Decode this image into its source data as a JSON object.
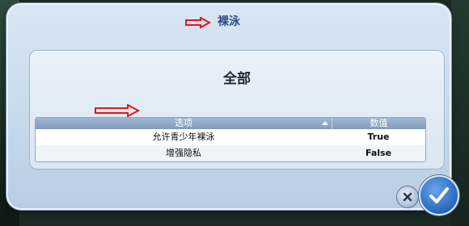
{
  "dialog": {
    "title": "裸泳",
    "section_title": "全部"
  },
  "table": {
    "headers": {
      "option": "选项",
      "value": "数值"
    },
    "rows": [
      {
        "option": "允许青少年裸泳",
        "value": "True"
      },
      {
        "option": "增强隐私",
        "value": "False"
      }
    ]
  },
  "buttons": {
    "cancel_icon": "close-icon",
    "ok_icon": "checkmark-icon"
  },
  "colors": {
    "annotation_arrow": "#e01818",
    "title_text": "#2d4f86",
    "ok_button": "#2f70c4"
  }
}
